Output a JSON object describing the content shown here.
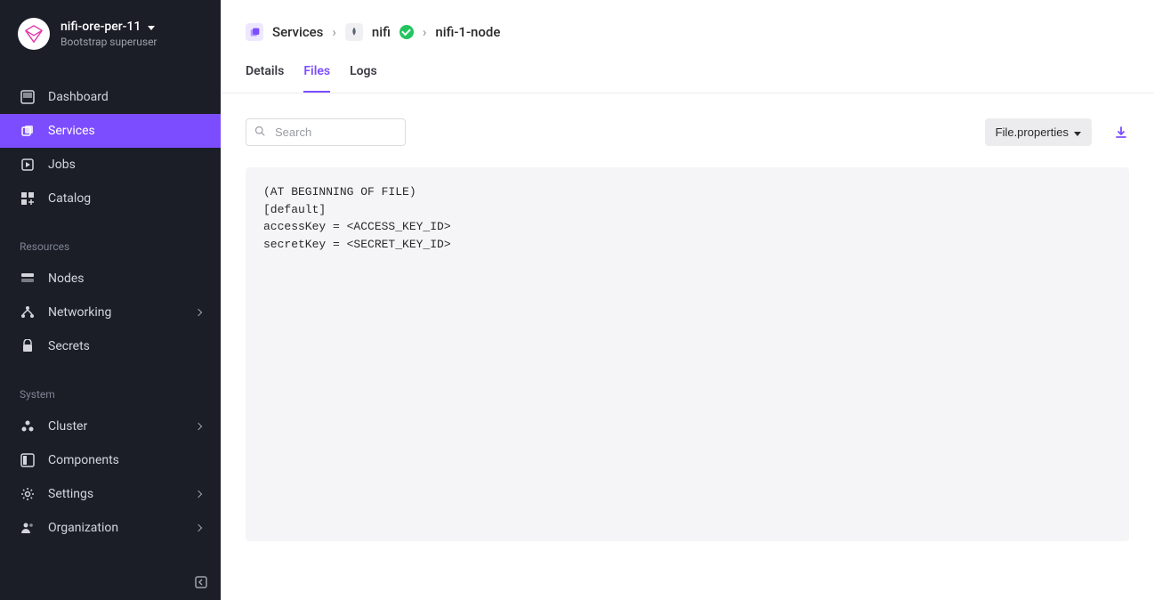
{
  "org": {
    "name": "nifi-ore-per-11",
    "subtitle": "Bootstrap superuser"
  },
  "sidebar": {
    "sections": [
      {
        "items": [
          {
            "label": "Dashboard",
            "icon": "dashboard-icon",
            "expandable": false,
            "active": false
          },
          {
            "label": "Services",
            "icon": "services-icon",
            "expandable": false,
            "active": true
          },
          {
            "label": "Jobs",
            "icon": "jobs-icon",
            "expandable": false,
            "active": false
          },
          {
            "label": "Catalog",
            "icon": "catalog-icon",
            "expandable": false,
            "active": false
          }
        ]
      },
      {
        "title": "Resources",
        "items": [
          {
            "label": "Nodes",
            "icon": "nodes-icon",
            "expandable": false
          },
          {
            "label": "Networking",
            "icon": "networking-icon",
            "expandable": true
          },
          {
            "label": "Secrets",
            "icon": "secrets-icon",
            "expandable": false
          }
        ]
      },
      {
        "title": "System",
        "items": [
          {
            "label": "Cluster",
            "icon": "cluster-icon",
            "expandable": true
          },
          {
            "label": "Components",
            "icon": "components-icon",
            "expandable": false
          },
          {
            "label": "Settings",
            "icon": "settings-icon",
            "expandable": true
          },
          {
            "label": "Organization",
            "icon": "organization-icon",
            "expandable": true
          }
        ]
      }
    ]
  },
  "breadcrumb": {
    "root": "Services",
    "service": "nifi",
    "node": "nifi-1-node"
  },
  "tabs": [
    {
      "label": "Details",
      "active": false
    },
    {
      "label": "Files",
      "active": true
    },
    {
      "label": "Logs",
      "active": false
    }
  ],
  "search": {
    "placeholder": "Search"
  },
  "file_dropdown": {
    "label": "File.properties"
  },
  "file_content": "(AT BEGINNING OF FILE)\n[default]\naccessKey = <ACCESS_KEY_ID>\nsecretKey = <SECRET_KEY_ID>"
}
